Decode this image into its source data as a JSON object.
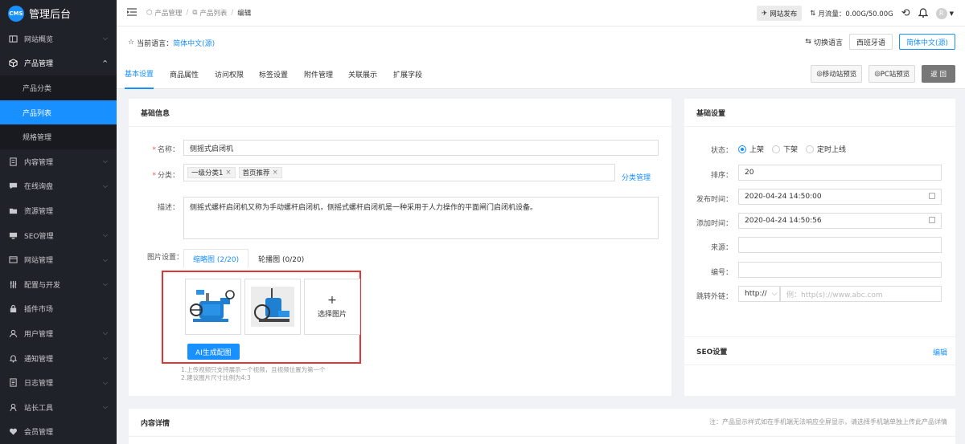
{
  "app": {
    "logo_badge": "CMS",
    "title": "管理后台"
  },
  "sidebar": {
    "items": [
      {
        "label": "网站概览",
        "icon": "dashboard-icon",
        "arrow": "v"
      },
      {
        "label": "产品管理",
        "icon": "cube-icon",
        "arrow": "^"
      },
      {
        "label": "内容管理",
        "icon": "document-icon",
        "arrow": "v"
      },
      {
        "label": "在线询盘",
        "icon": "chat-icon",
        "arrow": "v"
      },
      {
        "label": "资源管理",
        "icon": "folder-icon",
        "arrow": ""
      },
      {
        "label": "SEO管理",
        "icon": "monitor-icon",
        "arrow": "v"
      },
      {
        "label": "网站管理",
        "icon": "browser-icon",
        "arrow": "v"
      },
      {
        "label": "配置与开发",
        "icon": "sliders-icon",
        "arrow": "v"
      },
      {
        "label": "插件市场",
        "icon": "lock-icon",
        "arrow": ""
      },
      {
        "label": "用户管理",
        "icon": "user-icon",
        "arrow": "v"
      },
      {
        "label": "通知管理",
        "icon": "bell-icon",
        "arrow": "v"
      },
      {
        "label": "日志管理",
        "icon": "log-icon",
        "arrow": "v"
      },
      {
        "label": "站长工具",
        "icon": "tool-icon",
        "arrow": "v"
      },
      {
        "label": "会员管理",
        "icon": "heart-icon",
        "arrow": ""
      }
    ],
    "sub_items": [
      {
        "label": "产品分类"
      },
      {
        "label": "产品列表"
      },
      {
        "label": "规格管理"
      }
    ]
  },
  "topbar": {
    "breadcrumb": [
      "产品管理",
      "产品列表",
      "编辑"
    ],
    "publish": "网站发布",
    "traffic": "月流量：0.00G/50.00G",
    "avatar": "R"
  },
  "langbar": {
    "current_label": "当前语言：",
    "current_value": "简体中文(源)",
    "switch_label": "切换语言",
    "buttons": [
      "西班牙语",
      "简体中文(源)"
    ]
  },
  "tabs": [
    "基本设置",
    "商品属性",
    "访问权限",
    "标签设置",
    "附件管理",
    "关联展示",
    "扩展字段"
  ],
  "actions": {
    "mobile_preview": "移动站预览",
    "pc_preview": "PC站预览",
    "back": "返 回"
  },
  "basic_info": {
    "title": "基础信息",
    "name_label": "名称：",
    "name_value": "侧摇式启闭机",
    "category_label": "分类：",
    "categories": [
      "一级分类1",
      "首页推荐"
    ],
    "category_manage": "分类管理",
    "desc_label": "描述：",
    "desc_value": "侧摇式螺杆启闭机又称为手动螺杆启闭机，侧摇式螺杆启闭机是一种采用于人力操作的平面闸门启闭机设备。",
    "image_label": "图片设置：",
    "image_tabs": [
      "缩略图 (2/20)",
      "轮播图 (0/20)"
    ],
    "add_picture": "选择图片",
    "ai_button": "AI生成配图",
    "hints": [
      "1.上传视频只支持展示一个视频，且视频位置为第一个",
      "2.建议图片尺寸比例为4:3"
    ]
  },
  "base_settings": {
    "title": "基础设置",
    "status_label": "状态：",
    "status_options": [
      "上架",
      "下架",
      "定时上线"
    ],
    "status_selected": 0,
    "sort_label": "排序：",
    "sort_value": "20",
    "publish_label": "发布时间：",
    "publish_value": "2020-04-24 14:50:00",
    "added_label": "添加时间：",
    "added_value": "2020-04-24 14:50:56",
    "source_label": "来源：",
    "code_label": "编号：",
    "link_label": "跳转外链：",
    "link_protocol": "http://",
    "link_placeholder": "例：http(s)://www.abc.com"
  },
  "seo": {
    "title": "SEO设置",
    "edit": "编辑"
  },
  "content": {
    "title": "内容详情",
    "note": "注：产品显示样式如在手机端无法响应全屏显示，请选择手机端单独上传此产品详情"
  },
  "colors": {
    "accent": "#1890ff",
    "sidebar": "#20222a",
    "highlight_border": "#e03636"
  }
}
